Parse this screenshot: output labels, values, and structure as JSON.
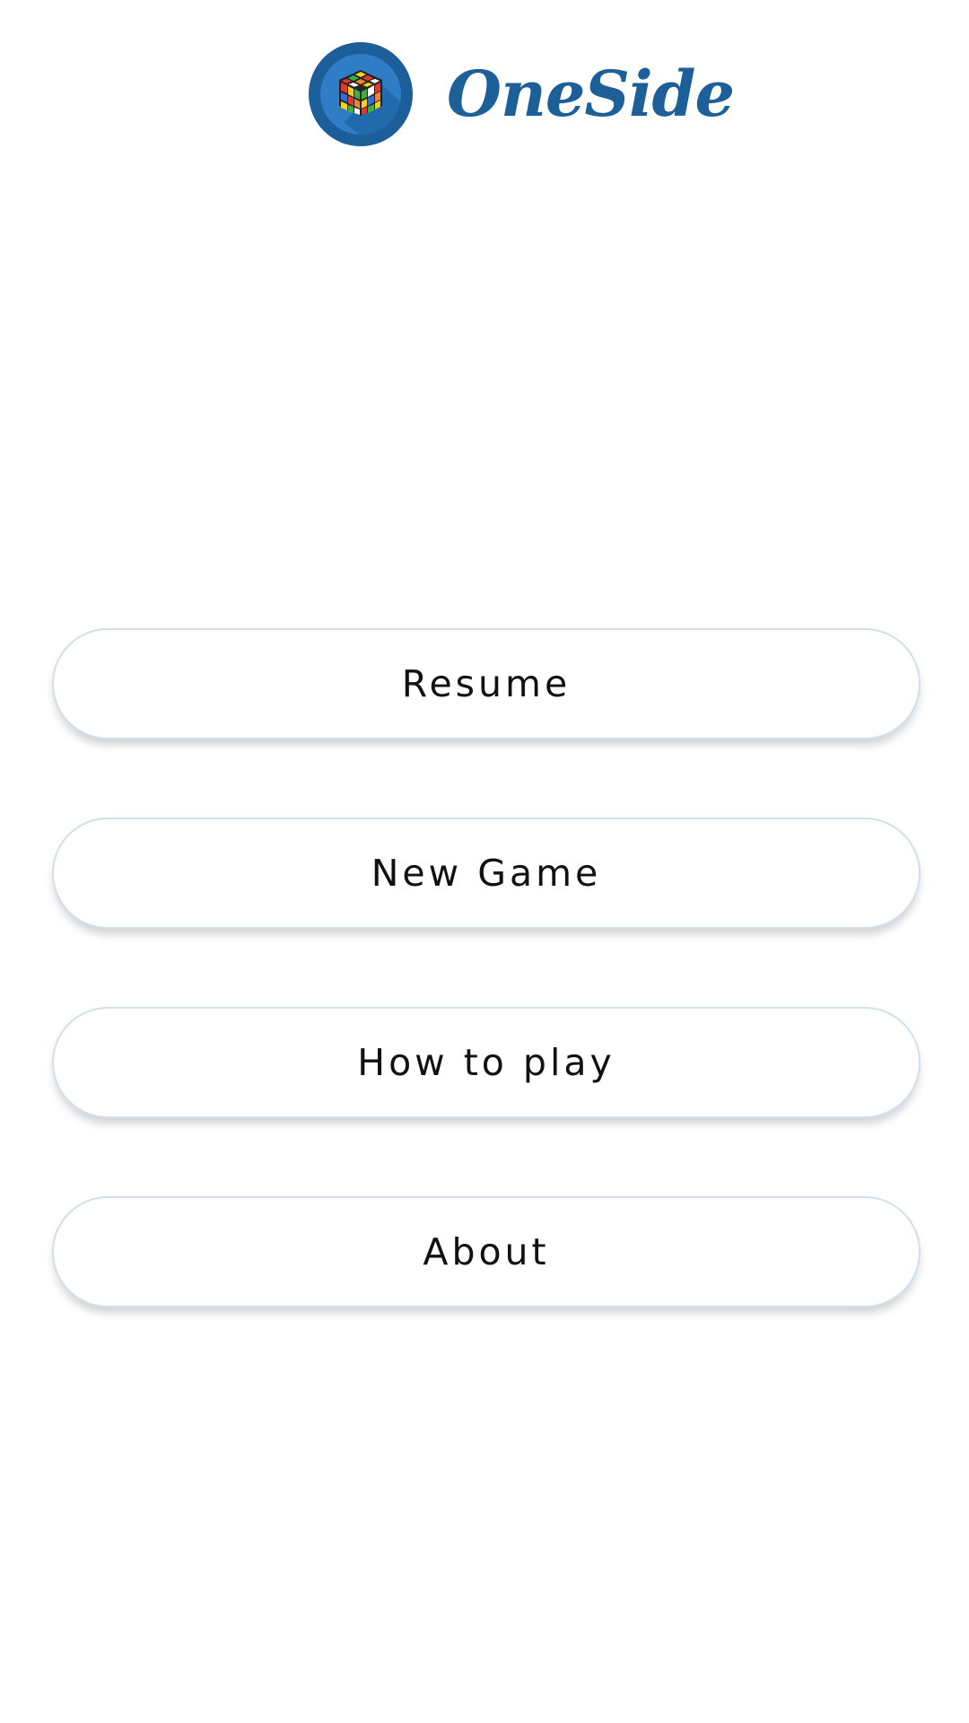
{
  "app": {
    "title": "OneSide",
    "brand_color": "#1d5f98",
    "logo_icon": "rubiks-cube-icon"
  },
  "menu": {
    "items": [
      {
        "label": "Resume"
      },
      {
        "label": "New Game"
      },
      {
        "label": "How to play"
      },
      {
        "label": "About"
      }
    ]
  }
}
